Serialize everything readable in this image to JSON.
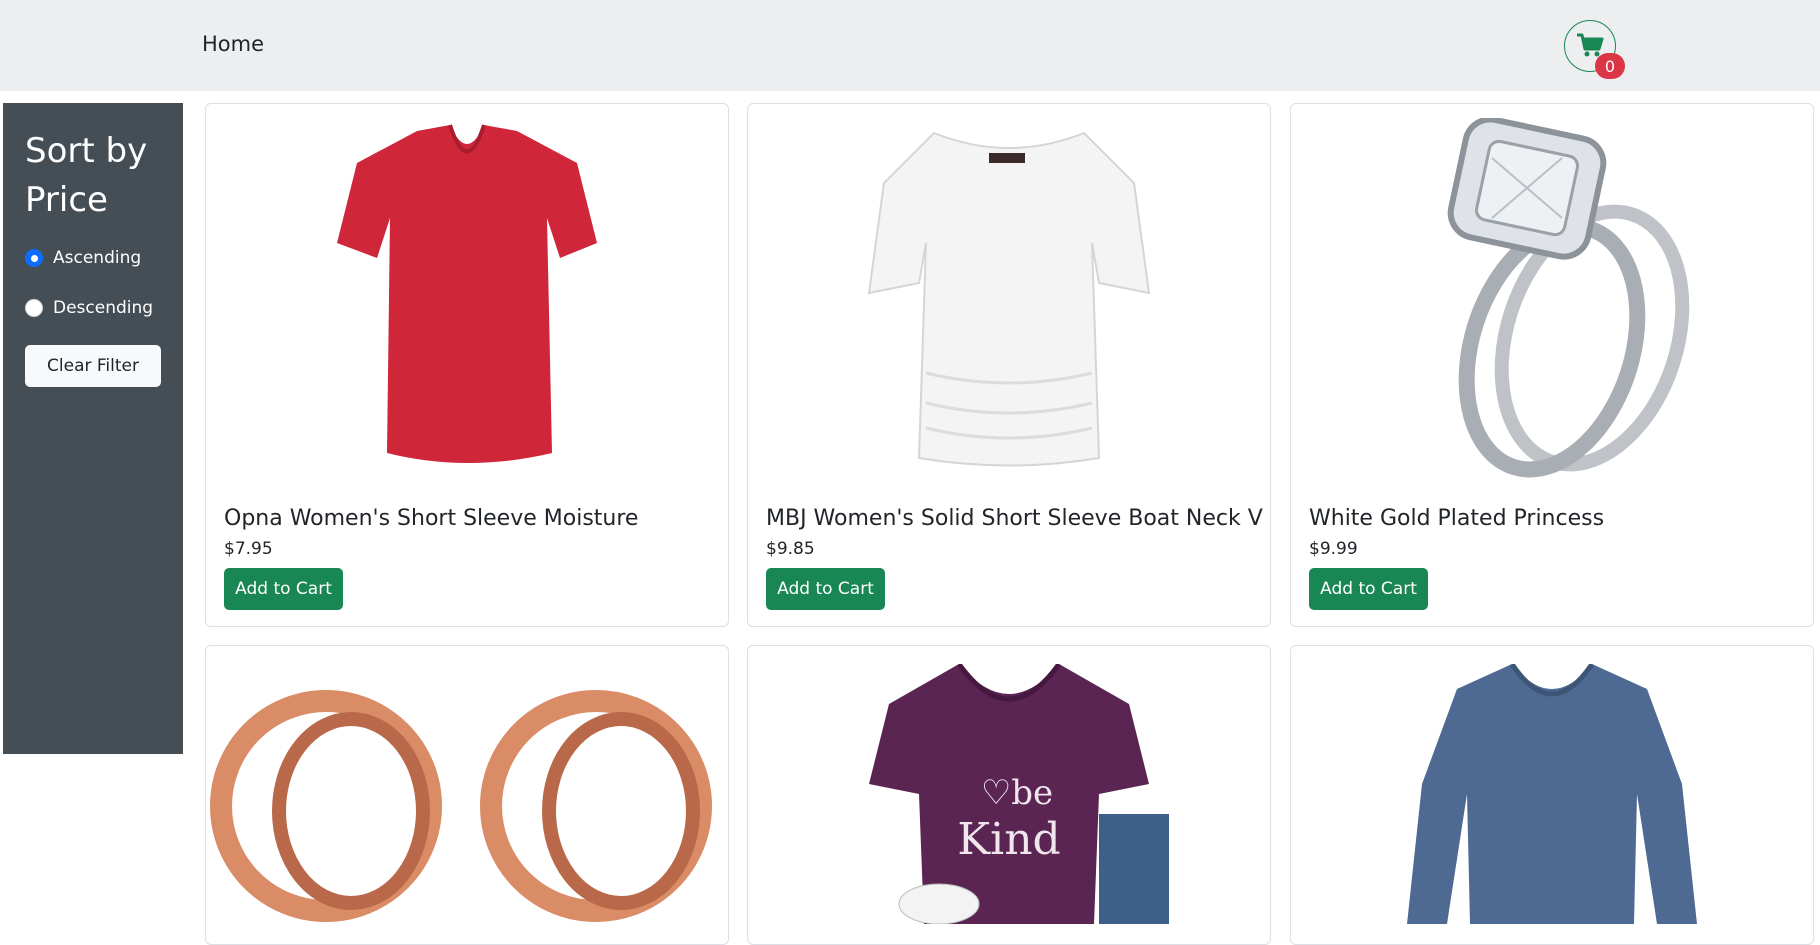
{
  "nav": {
    "home_label": "Home",
    "cart_count": "0"
  },
  "sidebar": {
    "title": "Sort by Price",
    "options": [
      {
        "label": "Ascending",
        "checked": true
      },
      {
        "label": "Descending",
        "checked": false
      }
    ],
    "clear_label": "Clear Filter"
  },
  "products": [
    {
      "title": "Opna Women's Short Sleeve Moisture",
      "price": "$7.95",
      "button": "Add to Cart",
      "image": "red-tshirt"
    },
    {
      "title": "MBJ Women's Solid Short Sleeve Boat Neck V",
      "price": "$9.85",
      "button": "Add to Cart",
      "image": "white-top"
    },
    {
      "title": "White Gold Plated Princess",
      "price": "$9.99",
      "button": "Add to Cart",
      "image": "diamond-ring"
    },
    {
      "image": "rose-gold-plugs"
    },
    {
      "image": "purple-be-kind-tee"
    },
    {
      "image": "blue-long-sleeve"
    }
  ],
  "colors": {
    "accent": "#198754",
    "badge": "#dc3545",
    "sidebar": "#454d55",
    "navbar": "#eceef0"
  }
}
